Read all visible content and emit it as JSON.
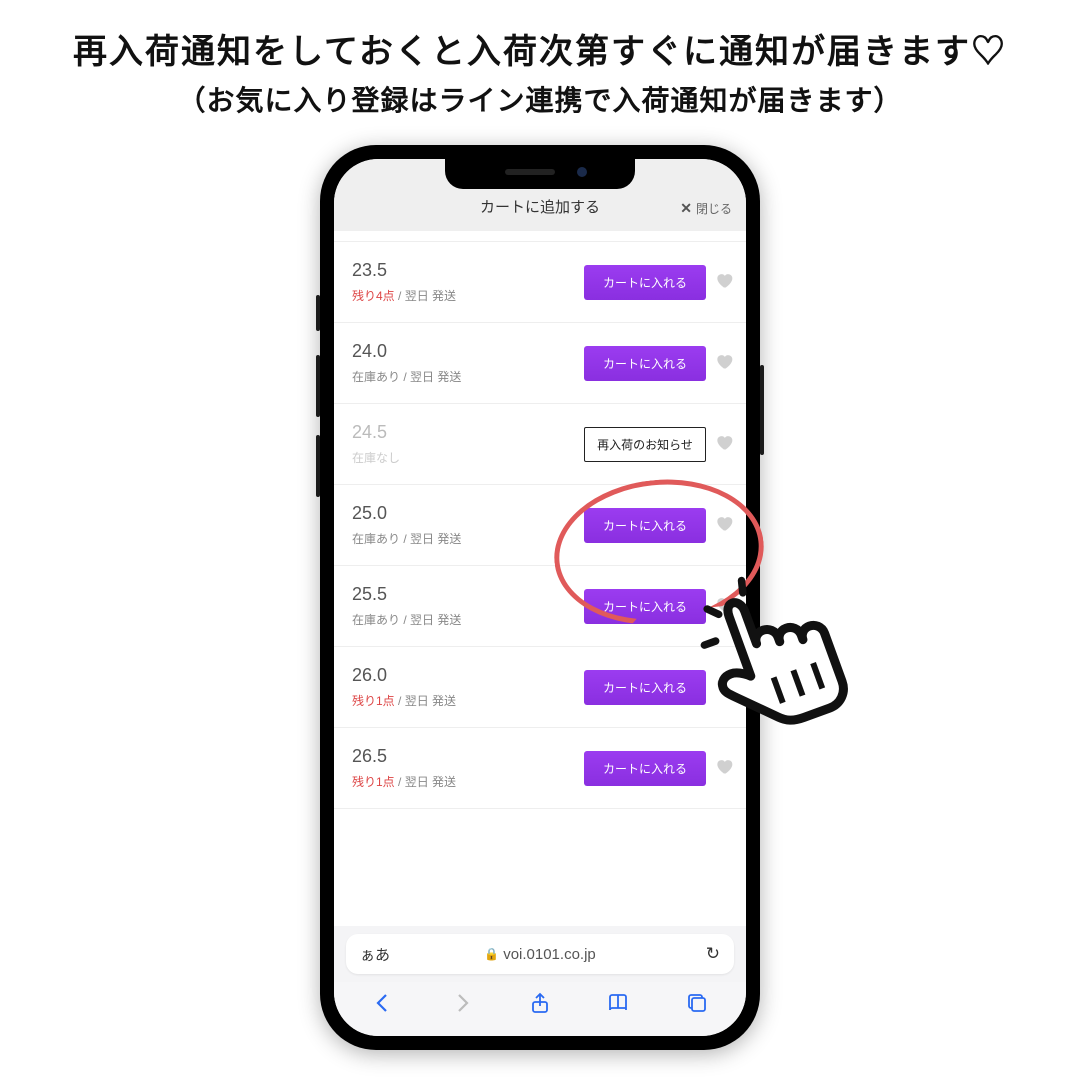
{
  "headline": {
    "main": "再入荷通知をしておくと入荷次第すぐに通知が届きます♡",
    "sub": "（お気に入り登録はライン連携で入荷通知が届きます）"
  },
  "modal": {
    "title": "カートに追加する",
    "close_label": "閉じる"
  },
  "buttons": {
    "add": "カートに入れる",
    "restock": "再入荷のお知らせ"
  },
  "shipping_suffix": " / 翌日 発送",
  "rows": [
    {
      "size": "23.5",
      "stock_text": "残り4点",
      "stock_type": "low",
      "available": true
    },
    {
      "size": "24.0",
      "stock_text": "在庫あり",
      "stock_type": "in",
      "available": true
    },
    {
      "size": "24.5",
      "stock_text": "在庫なし",
      "stock_type": "none",
      "available": false
    },
    {
      "size": "25.0",
      "stock_text": "在庫あり",
      "stock_type": "in",
      "available": true
    },
    {
      "size": "25.5",
      "stock_text": "在庫あり",
      "stock_type": "in",
      "available": true
    },
    {
      "size": "26.0",
      "stock_text": "残り1点",
      "stock_type": "low",
      "available": true
    },
    {
      "size": "26.5",
      "stock_text": "残り1点",
      "stock_type": "low",
      "available": true
    }
  ],
  "browser": {
    "text_size": "ぁあ",
    "domain": "voi.0101.co.jp"
  }
}
